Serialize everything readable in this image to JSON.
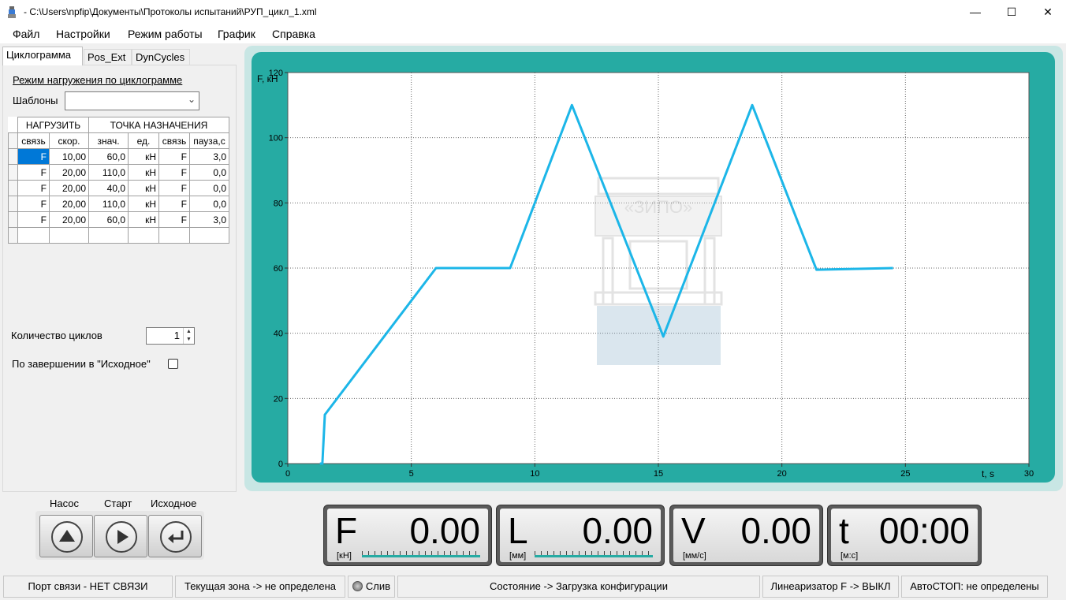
{
  "window": {
    "title": "- C:\\Users\\npfip\\Документы\\Протоколы испытаний\\РУП_цикл_1.xml",
    "minimize": "—",
    "maximize": "☐",
    "close": "✕"
  },
  "menu": [
    "Файл",
    "Настройки",
    "Режим работы",
    "График",
    "Справка"
  ],
  "tabs": [
    "Циклограмма",
    "Pos_Ext",
    "DynCycles"
  ],
  "left": {
    "mode_link": "Режим нагружения по циклограмме",
    "templates_label": "Шаблоны",
    "templates_value": "",
    "table": {
      "group_headers": [
        "НАГРУЗИТЬ",
        "ТОЧКА НАЗНАЧЕНИЯ"
      ],
      "columns": [
        "связь",
        "скор.",
        "знач.",
        "ед.",
        "связь",
        "пауза,с"
      ],
      "rows": [
        [
          "F",
          "10,00",
          "60,0",
          "кН",
          "F",
          "3,0"
        ],
        [
          "F",
          "20,00",
          "110,0",
          "кН",
          "F",
          "0,0"
        ],
        [
          "F",
          "20,00",
          "40,0",
          "кН",
          "F",
          "0,0"
        ],
        [
          "F",
          "20,00",
          "110,0",
          "кН",
          "F",
          "0,0"
        ],
        [
          "F",
          "20,00",
          "60,0",
          "кН",
          "F",
          "3,0"
        ]
      ]
    },
    "cycles_label": "Количество циклов",
    "cycles_value": "1",
    "finish_label": "По завершении в \"Исходное\"",
    "finish_checked": false
  },
  "controls": {
    "labels": [
      "Насос",
      "Старт",
      "Исходное"
    ],
    "icons": [
      "up-arrow-icon",
      "play-icon",
      "return-icon"
    ]
  },
  "indicators": [
    {
      "symbol": "F",
      "value": "0.00",
      "unit": "[кН]",
      "scale": true
    },
    {
      "symbol": "L",
      "value": "0.00",
      "unit": "[мм]",
      "scale": true
    },
    {
      "symbol": "V",
      "value": "0.00",
      "unit": "[мм/с]",
      "scale": false
    },
    {
      "symbol": "t",
      "value": "00:00",
      "unit": "[м:с]",
      "scale": false
    }
  ],
  "status": {
    "port": "Порт связи  - НЕТ СВЯЗИ",
    "zone": "Текущая зона -> не определена",
    "drain": "Слив",
    "state": "Состояние -> Загрузка конфигурации",
    "linearizer": "Линеаризатор F -> ВЫКЛ",
    "autostop": "АвтоСТОП: не определены"
  },
  "colors": {
    "accent": "#26aba3",
    "series": "#1cb6e8",
    "selection": "#0078d7"
  },
  "chart_data": {
    "type": "line",
    "xlabel": "t, s",
    "ylabel": "F, кН",
    "xlim": [
      0,
      30
    ],
    "ylim": [
      0,
      120
    ],
    "xticks": [
      0,
      5,
      10,
      15,
      20,
      25,
      30
    ],
    "yticks": [
      0,
      20,
      40,
      60,
      80,
      100,
      120
    ],
    "grid": true,
    "watermark": "«ЗИПО»",
    "series": [
      {
        "x": [
          1.3,
          1.4,
          1.5,
          6.0,
          9.0,
          11.5,
          15.2,
          18.8,
          21.4,
          24.5
        ],
        "y": [
          0,
          0,
          15,
          60,
          60,
          110,
          39,
          110,
          59.5,
          60
        ]
      }
    ]
  }
}
